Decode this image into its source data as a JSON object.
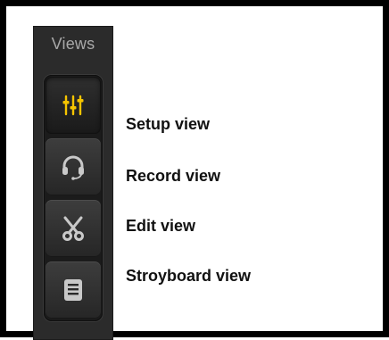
{
  "panel": {
    "title": "Views"
  },
  "views": [
    {
      "label": "Setup view",
      "icon": "mixer-sliders-icon",
      "active": true
    },
    {
      "label": "Record view",
      "icon": "headphones-icon",
      "active": false
    },
    {
      "label": "Edit view",
      "icon": "scissors-icon",
      "active": false
    },
    {
      "label": "Stroyboard view",
      "icon": "storyboard-icon",
      "active": false
    }
  ],
  "colors": {
    "active_icon": "#f5c400",
    "inactive_icon": "#c9c9c9",
    "panel_bg": "#2b2b2b"
  }
}
